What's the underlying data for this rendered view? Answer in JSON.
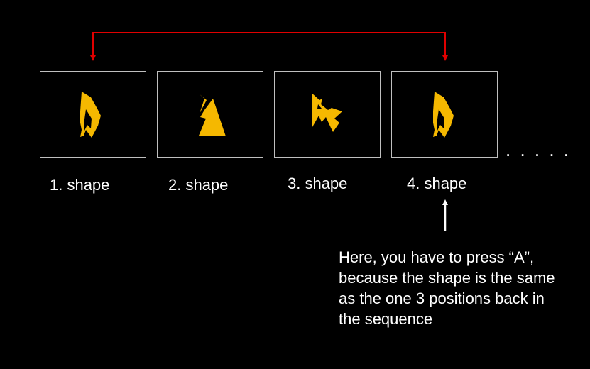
{
  "sequence": {
    "items": [
      {
        "label": "1. shape",
        "shape": "kite-with-notch"
      },
      {
        "label": "2. shape",
        "shape": "zigzag-wedge"
      },
      {
        "label": "3. shape",
        "shape": "jagged-fragment"
      },
      {
        "label": "4. shape",
        "shape": "kite-with-notch"
      }
    ],
    "continuation": ". . . . ."
  },
  "explanation": {
    "lines": [
      "Here, you have to press “A”,",
      "because the shape is the same",
      "as the one 3 positions back in",
      "the sequence"
    ]
  },
  "colors": {
    "background": "#000000",
    "shape_fill": "#f5b800",
    "frame_border": "#bfbfbf",
    "connector": "#e00000",
    "pointer_arrow": "#ffffff",
    "text": "#ffffff"
  }
}
